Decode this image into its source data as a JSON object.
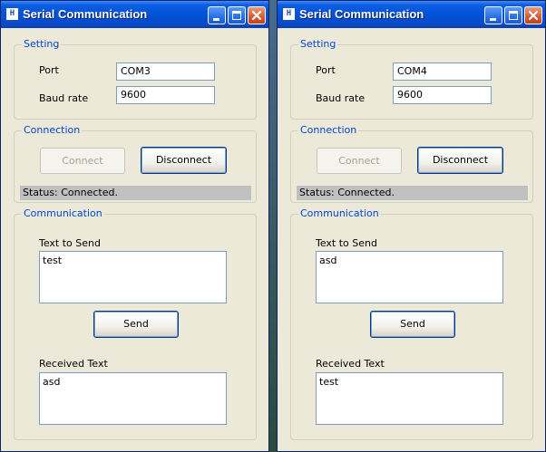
{
  "windows": [
    {
      "title": "Serial Communication",
      "setting": {
        "group_title": "Setting",
        "port_label": "Port",
        "port_value": "COM3",
        "baud_label": "Baud rate",
        "baud_value": "9600"
      },
      "connection": {
        "group_title": "Connection",
        "connect_label": "Connect",
        "disconnect_label": "Disconnect",
        "status": "Status: Connected."
      },
      "communication": {
        "group_title": "Communication",
        "send_label": "Text to Send",
        "send_text": "test",
        "send_button": "Send",
        "received_label": "Received Text",
        "received_text": "asd"
      }
    },
    {
      "title": "Serial Communication",
      "setting": {
        "group_title": "Setting",
        "port_label": "Port",
        "port_value": "COM4",
        "baud_label": "Baud rate",
        "baud_value": "9600"
      },
      "connection": {
        "group_title": "Connection",
        "connect_label": "Connect",
        "disconnect_label": "Disconnect",
        "status": "Status: Connected."
      },
      "communication": {
        "group_title": "Communication",
        "send_label": "Text to Send",
        "send_text": "asd",
        "send_button": "Send",
        "received_label": "Received Text",
        "received_text": "test"
      }
    }
  ],
  "icons": {
    "app": "serial-app-icon",
    "minimize": "minimize-icon",
    "maximize": "maximize-icon",
    "close": "close-icon"
  },
  "colors": {
    "titlebar": "#0051d8",
    "window_bg": "#ece9d8",
    "group_title": "#0046d5",
    "status_bg": "#c0c0c0"
  }
}
